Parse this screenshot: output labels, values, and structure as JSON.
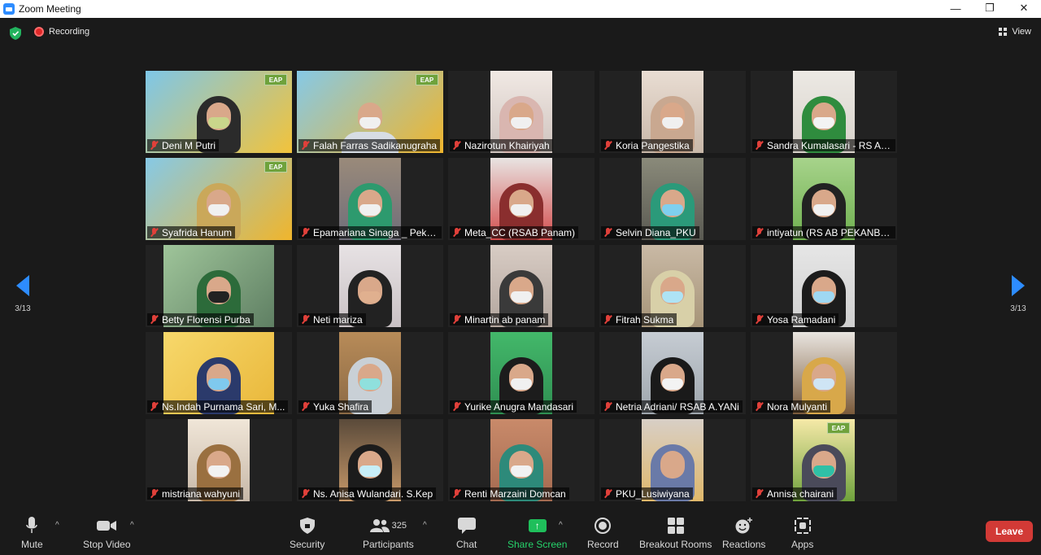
{
  "window": {
    "title": "Zoom Meeting",
    "minimize": "—",
    "restore": "❐",
    "close": "✕"
  },
  "topbar": {
    "recording_label": "Recording",
    "view_label": "View"
  },
  "pagination": {
    "left_label": "3/13",
    "right_label": "3/13"
  },
  "participants": [
    {
      "name": "Deni M Putri",
      "muted": true
    },
    {
      "name": "Falah Farras Sadikanugraha",
      "muted": true
    },
    {
      "name": "Nazirotun Khairiyah",
      "muted": true
    },
    {
      "name": "Koria Pangestika",
      "muted": true
    },
    {
      "name": "Sandra Kumalasari - RS Aw...",
      "muted": true
    },
    {
      "name": "Syafrida Hanum",
      "muted": true
    },
    {
      "name": "Epamariana Sinaga _ Peka...",
      "muted": true
    },
    {
      "name": "Meta_CC (RSAB Panam)",
      "muted": true
    },
    {
      "name": "Selvin Diana_PKU",
      "muted": true
    },
    {
      "name": "intiyatun (RS AB PEKANBAR...",
      "muted": true
    },
    {
      "name": "Betty Florensi Purba",
      "muted": true
    },
    {
      "name": "Neti mariza",
      "muted": true
    },
    {
      "name": "Minartin ab panam",
      "muted": true
    },
    {
      "name": "Fitrah Sukma",
      "muted": true
    },
    {
      "name": "Yosa Ramadani",
      "muted": true
    },
    {
      "name": "Ns.Indah Purnama Sari, M...",
      "muted": true
    },
    {
      "name": "Yuka Shafira",
      "muted": true
    },
    {
      "name": "Yurike Anugra Mandasari",
      "muted": true
    },
    {
      "name": "Netria Adriani/ RSAB A.YANi",
      "muted": true
    },
    {
      "name": "Nora Mulyanti",
      "muted": true
    },
    {
      "name": "mistriana wahyuni",
      "muted": true
    },
    {
      "name": "Ns. Anisa Wulandari. S.Kep",
      "muted": true
    },
    {
      "name": "Renti Marzaini Domcan",
      "muted": true
    },
    {
      "name": "PKU_Lusiwiyana",
      "muted": true
    },
    {
      "name": "Annisa chairani",
      "muted": true
    }
  ],
  "toolbar": {
    "mute": "Mute",
    "stop_video": "Stop Video",
    "security": "Security",
    "participants": "Participants",
    "participants_count": "325",
    "chat": "Chat",
    "share_screen": "Share Screen",
    "record": "Record",
    "breakout_rooms": "Breakout Rooms",
    "reactions": "Reactions",
    "apps": "Apps",
    "leave": "Leave"
  },
  "colors": {
    "accent": "#2d8cff",
    "share_green": "#26d36b",
    "leave_red": "#d23a36",
    "muted_red": "#e0403a"
  }
}
